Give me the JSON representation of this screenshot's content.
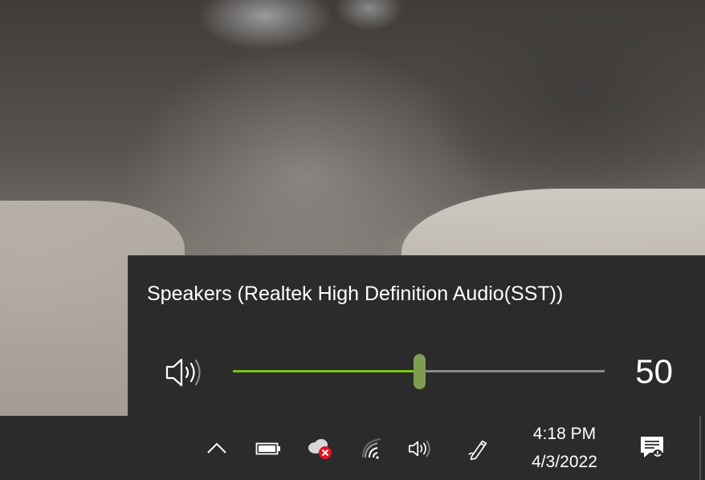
{
  "volume_flyout": {
    "device_name": "Speakers (Realtek High Definition Audio(SST))",
    "volume": 50,
    "volume_label": "50",
    "accent_color": "#7ac418",
    "thumb_color": "#7d9e52"
  },
  "taskbar": {
    "tray_icons": [
      "chevron-up-icon",
      "battery-icon",
      "onedrive-error-icon",
      "wifi-icon",
      "speaker-icon",
      "pen-icon"
    ],
    "clock": {
      "time": "4:18 PM",
      "date": "4/3/2022"
    },
    "notification_icon": "notification-center-icon"
  }
}
